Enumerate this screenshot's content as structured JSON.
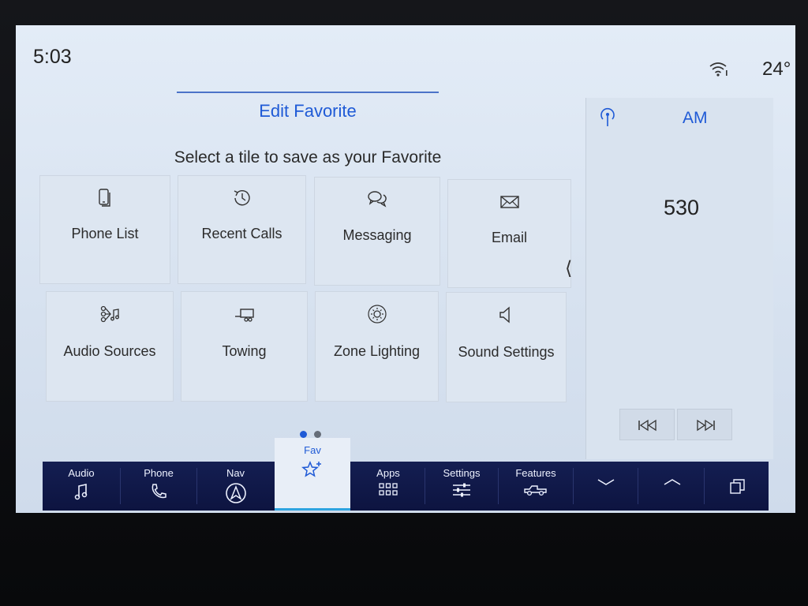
{
  "status": {
    "time": "5:03",
    "temperature": "24°",
    "wifi_icon": "wifi-icon"
  },
  "favorites": {
    "title": "Edit Favorite",
    "subtitle": "Select a tile to save as your Favorite",
    "tiles": [
      {
        "label": "Phone List",
        "icon": "phone-list-icon"
      },
      {
        "label": "Recent Calls",
        "icon": "recent-calls-icon"
      },
      {
        "label": "Messaging",
        "icon": "messaging-icon"
      },
      {
        "label": "Email",
        "icon": "email-icon"
      },
      {
        "label": "Audio Sources",
        "icon": "audio-sources-icon"
      },
      {
        "label": "Towing",
        "icon": "towing-icon"
      },
      {
        "label": "Zone Lighting",
        "icon": "zone-lighting-icon"
      },
      {
        "label": "Sound Settings",
        "icon": "sound-settings-icon"
      }
    ],
    "page_count": 2,
    "current_page": 1
  },
  "radio": {
    "band": "AM",
    "frequency": "530"
  },
  "nav": {
    "audio": "Audio",
    "phone": "Phone",
    "nav": "Nav",
    "fav": "Fav",
    "apps": "Apps",
    "settings": "Settings",
    "features": "Features"
  },
  "colors": {
    "accent": "#1f5ad6",
    "nav_bg": "#141e52",
    "screen_bg": "#e3ecf7",
    "active_bar": "#2fa4e0"
  }
}
